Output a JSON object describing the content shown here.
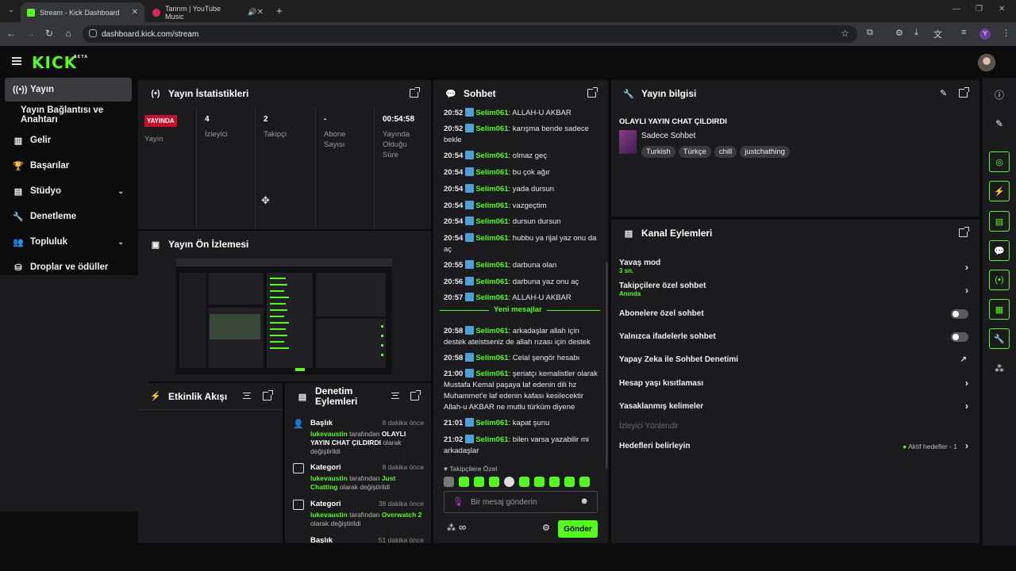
{
  "browser": {
    "tabs": [
      {
        "title": "Stream - Kick Dashboard",
        "active": true
      },
      {
        "title": "Tanrım | YouTube Music",
        "active": false
      }
    ],
    "url": "dashboard.kick.com/stream",
    "profile_initial": "Y"
  },
  "app": {
    "logo": "KICK",
    "logo_badge": "BETA"
  },
  "sidebar": {
    "items": [
      {
        "label": "Yayın",
        "icon": "broadcast-icon",
        "active": true
      },
      {
        "label": "Yayın Bağlantısı ve Anahtarı",
        "icon": "",
        "active": false
      },
      {
        "label": "Gelir",
        "icon": "revenue-chart-icon",
        "active": false
      },
      {
        "label": "Başarılar",
        "icon": "trophy-icon",
        "active": false
      },
      {
        "label": "Stüdyo",
        "icon": "studio-icon",
        "active": false,
        "expandable": true
      },
      {
        "label": "Denetleme",
        "icon": "wrench-icon",
        "active": false
      },
      {
        "label": "Topluluk",
        "icon": "community-icon",
        "active": false,
        "expandable": true
      },
      {
        "label": "Droplar ve ödüller",
        "icon": "drops-icon",
        "active": false
      }
    ]
  },
  "stats": {
    "title": "Yayın İstatistikleri",
    "columns": [
      {
        "value": "YAYINDA",
        "label": "Yayın"
      },
      {
        "value": "4",
        "label": "İzleyici"
      },
      {
        "value": "2",
        "label": "Takipçi"
      },
      {
        "value": "-",
        "label": "Abone Sayısı"
      },
      {
        "value": "00:54:58",
        "label": "Yayında Olduğu Süre"
      }
    ]
  },
  "preview": {
    "title": "Yayın Ön İzlemesi"
  },
  "activity": {
    "title": "Etkinlik Akışı"
  },
  "moderation": {
    "title": "Denetim Eylemleri",
    "items": [
      {
        "type": "Başlık",
        "ago": "8 dakika önce",
        "user": "lukevaustin",
        "mid": "tarafından",
        "value": "OLAYLI YAYIN CHAT ÇILDIRDI",
        "tail": "olarak değiştirildi"
      },
      {
        "type": "Kategori",
        "ago": "8 dakika önce",
        "user": "lukevaustin",
        "mid": "tarafından",
        "value": "Just Chatting",
        "tail": "olarak değiştirildi"
      },
      {
        "type": "Kategori",
        "ago": "38 dakika önce",
        "user": "lukevaustin",
        "mid": "tarafından",
        "value": "Overwatch 2",
        "tail": "olarak değiştirildi"
      },
      {
        "type": "Başlık",
        "ago": "51 dakika önce",
        "user": "",
        "mid": "",
        "value": "",
        "tail": ""
      }
    ]
  },
  "chat": {
    "title": "Sohbet",
    "messages": [
      {
        "time": "20:52",
        "user": "Selim061",
        "text": "ALLAH-U AKBAR"
      },
      {
        "time": "20:52",
        "user": "Selim061",
        "text": "karışma bende sadece bekle"
      },
      {
        "time": "20:54",
        "user": "Selim061",
        "text": "olmaz geç"
      },
      {
        "time": "20:54",
        "user": "Selim061",
        "text": "bu çok ağır"
      },
      {
        "time": "20:54",
        "user": "Selim061",
        "text": "yada dursun"
      },
      {
        "time": "20:54",
        "user": "Selim061",
        "text": "vazgeçtim"
      },
      {
        "time": "20:54",
        "user": "Selim061",
        "text": "dursun dursun"
      },
      {
        "time": "20:54",
        "user": "Selim061",
        "text": "hubbu ya rijal yaz onu da aç"
      },
      {
        "time": "20:55",
        "user": "Selim061",
        "text": "darbuna olan"
      },
      {
        "time": "20:56",
        "user": "Selim061",
        "text": "darbuna yaz onu aç"
      },
      {
        "time": "20:57",
        "user": "Selim061",
        "text": "ALLAH-U AKBAR"
      },
      {
        "time": "20:58",
        "user": "Selim061",
        "text": "arkadaşlar allah için destek ateistseniz de allah rızası için destek"
      },
      {
        "time": "20:58",
        "user": "Selim061",
        "text": "Celal şengör hesabı"
      },
      {
        "time": "21:00",
        "user": "Selim061",
        "text": "şeriatçı kemalistler olarak Mustafa Kemal paşaya laf edenin dili hz Muhammet'e laf edenin kafası kesilecektir Allah-u AKBAR ne mutlu türküm diyene"
      },
      {
        "time": "21:01",
        "user": "Selim061",
        "text": "kapat şunu"
      },
      {
        "time": "21:02",
        "user": "Selim061",
        "text": "bilen varsa yazabilir mi arkadaşlar"
      }
    ],
    "new_messages_label": "Yeni mesajlar",
    "followers_only_label": "Takipçilere Özel",
    "input_placeholder": "Bir mesaj gönderin",
    "send_label": "Gönder"
  },
  "stream_info": {
    "title": "Yayın bilgisi",
    "stream_title": "OLAYLI YAYIN CHAT ÇILDIRDI",
    "category": "Sadece Sohbet",
    "tags": [
      "Turkish",
      "Türkçe",
      "chill",
      "justchathing"
    ]
  },
  "channel_actions": {
    "title": "Kanal Eylemleri",
    "items": [
      {
        "label": "Yavaş mod",
        "sub": "3 sn.",
        "control": "chevron"
      },
      {
        "label": "Takipçilere özel sohbet",
        "sub": "Anında",
        "control": "chevron"
      },
      {
        "label": "Abonelere özel sohbet",
        "sub": "",
        "control": "toggle"
      },
      {
        "label": "Yalnızca ifadelerle sohbet",
        "sub": "",
        "control": "toggle"
      },
      {
        "label": "Yapay Zeka ile Sohbet Denetimi",
        "sub": "",
        "control": "external"
      },
      {
        "label": "Hesap yaşı kısıtlaması",
        "sub": "",
        "control": "chevron"
      },
      {
        "label": "Yasaklanmış kelimeler",
        "sub": "",
        "control": "chevron"
      },
      {
        "label": "İzleyici Yönlendir",
        "sub": "",
        "control": "none",
        "disabled": true
      },
      {
        "label": "Hedefleri belirleyin",
        "sub": "",
        "control": "chevron",
        "status": "Aktif hedefler - 1"
      }
    ]
  },
  "colors": {
    "accent": "#53fc18",
    "panel": "#1b1b1d",
    "live": "#c8102e"
  }
}
